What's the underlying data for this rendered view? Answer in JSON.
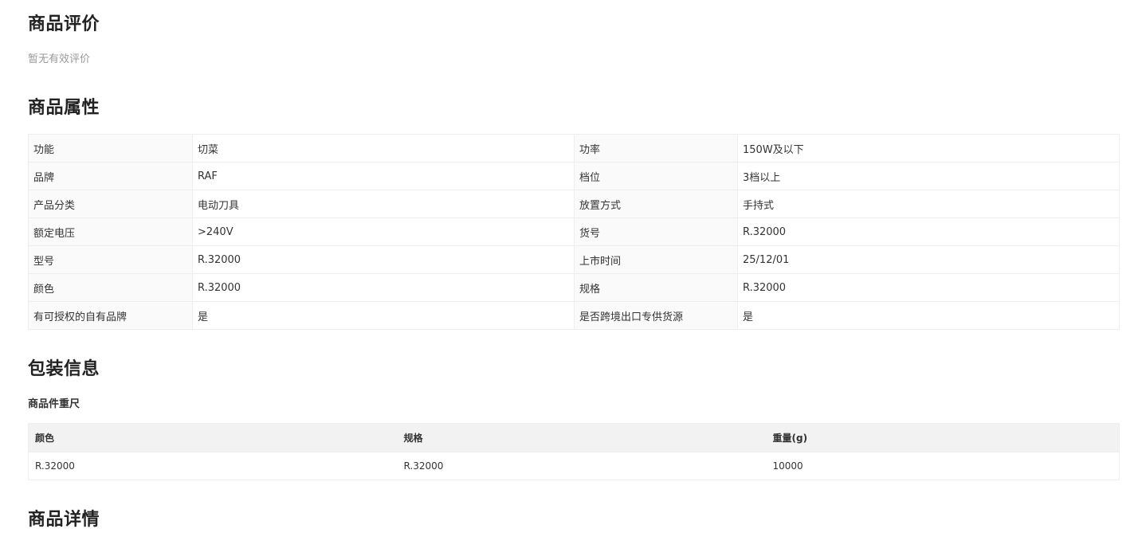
{
  "reviews": {
    "title": "商品评价",
    "empty_text": "暂无有效评价"
  },
  "attributes": {
    "title": "商品属性",
    "rows": [
      [
        "功能",
        "切菜",
        "功率",
        "150W及以下"
      ],
      [
        "品牌",
        "RAF",
        "档位",
        "3档以上"
      ],
      [
        "产品分类",
        "电动刀具",
        "放置方式",
        "手持式"
      ],
      [
        "额定电压",
        ">240V",
        "货号",
        "R.32000"
      ],
      [
        "型号",
        "R.32000",
        "上市时间",
        "25/12/01"
      ],
      [
        "颜色",
        "R.32000",
        "规格",
        "R.32000"
      ],
      [
        "有可授权的自有品牌",
        "是",
        "是否跨境出口专供货源",
        "是"
      ]
    ]
  },
  "packaging": {
    "title": "包装信息",
    "subtitle": "商品件重尺",
    "headers": [
      "颜色",
      "规格",
      "重量(g)"
    ],
    "rows": [
      [
        "R.32000",
        "R.32000",
        "10000"
      ]
    ]
  },
  "details": {
    "title": "商品详情"
  }
}
